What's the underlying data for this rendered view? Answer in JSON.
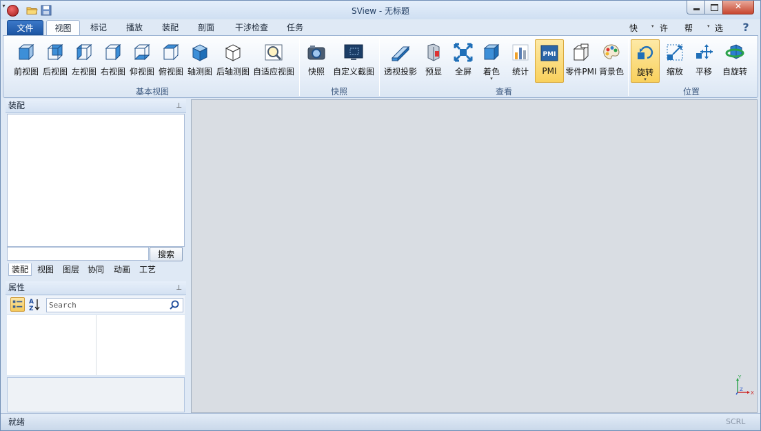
{
  "window": {
    "title": "SView - 无标题"
  },
  "quick_access": {
    "icons": [
      "app-logo-icon",
      "open-folder-icon",
      "save-icon",
      "qat-menu-icon"
    ]
  },
  "tabs": {
    "file": "文件",
    "items": [
      "视图",
      "标记",
      "播放",
      "装配",
      "剖面",
      "干涉检查",
      "任务"
    ],
    "active": "视图"
  },
  "right_menu": {
    "items": [
      "快传",
      "许可",
      "帮助",
      "选项"
    ],
    "help_symbol": "?"
  },
  "ribbon": {
    "groups": {
      "basic_views": "基本视图",
      "snapshot": "快照",
      "view": "查看",
      "position": "位置"
    },
    "basic_views": [
      "前视图",
      "后视图",
      "左视图",
      "右视图",
      "仰视图",
      "俯视图",
      "轴测图",
      "后轴测图",
      "自适应视图"
    ],
    "snapshot": [
      "快照",
      "自定义截图"
    ],
    "view": [
      "透视投影",
      "预显",
      "全屏",
      "着色",
      "统计",
      "PMI",
      "零件PMI",
      "背景色"
    ],
    "position": [
      "旋转",
      "缩放",
      "平移",
      "自旋转"
    ],
    "pmi_icon_text": "PMI",
    "selected": [
      "PMI",
      "旋转"
    ],
    "accent_color": "#f9d15d"
  },
  "assembly_panel": {
    "title": "装配",
    "search_button": "搜索",
    "tabs": [
      "装配",
      "视图",
      "图层",
      "协同",
      "动画",
      "工艺"
    ],
    "active_tab": "装配"
  },
  "properties_panel": {
    "title": "属性",
    "search_placeholder": "Search"
  },
  "viewport": {
    "axis": {
      "y": "Y",
      "z": "Z",
      "x": "X"
    }
  },
  "status": {
    "left": "就绪",
    "right": "SCRL"
  }
}
